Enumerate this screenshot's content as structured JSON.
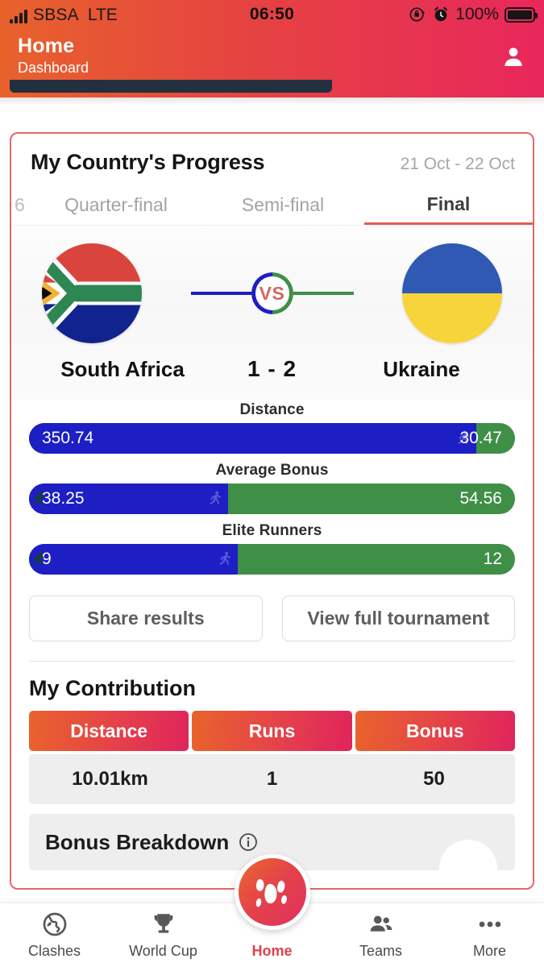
{
  "status_bar": {
    "carrier": "SBSA",
    "network": "LTE",
    "time": "06:50",
    "battery_percent": "100%",
    "icons": [
      "signal-bars-icon",
      "rotation-lock-icon",
      "alarm-icon",
      "battery-icon"
    ]
  },
  "app_header": {
    "title": "Home",
    "subtitle": "Dashboard",
    "avatar_icon": "person-icon",
    "accent_gradient": [
      "#e8622c",
      "#e8275c"
    ]
  },
  "card": {
    "title": "My Country's Progress",
    "date_range": "21 Oct - 22 Oct",
    "border_color": "#e06a63",
    "tabs": [
      {
        "label": "",
        "active": false,
        "clipped": true
      },
      {
        "label": "Quarter-final",
        "active": false
      },
      {
        "label": "Semi-final",
        "active": false
      },
      {
        "label": "Final",
        "active": true
      }
    ],
    "match": {
      "home": {
        "name": "South Africa",
        "flag": "south-africa-flag"
      },
      "away": {
        "name": "Ukraine",
        "flag": "ukraine-flag"
      },
      "score": "1 - 2",
      "vs_label": "VS",
      "home_color": "#1d1ec4",
      "away_color": "#3f8f47"
    },
    "stats": [
      {
        "label": "Distance",
        "home_value": "350.74",
        "away_value": "30.47",
        "home_pct": 92
      },
      {
        "label": "Average Bonus",
        "home_value": "38.25",
        "away_value": "54.56",
        "home_pct": 41
      },
      {
        "label": "Elite Runners",
        "home_value": "9",
        "away_value": "12",
        "home_pct": 43
      }
    ],
    "actions": [
      {
        "label": "Share results"
      },
      {
        "label": "View full tournament"
      }
    ],
    "contribution": {
      "title": "My Contribution",
      "columns": [
        "Distance",
        "Runs",
        "Bonus"
      ],
      "values": [
        "10.01km",
        "1",
        "50"
      ]
    },
    "bonus_breakdown": {
      "title": "Bonus Breakdown",
      "info_icon": "info-icon"
    }
  },
  "bottom_nav": {
    "items": [
      {
        "label": "Clashes",
        "icon": "globe-icon",
        "active": false
      },
      {
        "label": "World Cup",
        "icon": "trophy-icon",
        "active": false
      },
      {
        "label": "Home",
        "icon": "footprint-icon",
        "active": true
      },
      {
        "label": "Teams",
        "icon": "people-icon",
        "active": false
      },
      {
        "label": "More",
        "icon": "ellipsis-icon",
        "active": false
      }
    ],
    "active_color": "#e0414c"
  },
  "chart_data": {
    "type": "bar",
    "title": "My Country's Progress - Final",
    "categories": [
      "Distance",
      "Average Bonus",
      "Elite Runners"
    ],
    "series": [
      {
        "name": "South Africa",
        "values": [
          350.74,
          38.25,
          9
        ],
        "color": "#1d1ec4"
      },
      {
        "name": "Ukraine",
        "values": [
          30.47,
          54.56,
          12
        ],
        "color": "#3f8f47"
      }
    ],
    "orientation": "horizontal",
    "stacked": true,
    "legend": "inline-values",
    "grid": false
  }
}
